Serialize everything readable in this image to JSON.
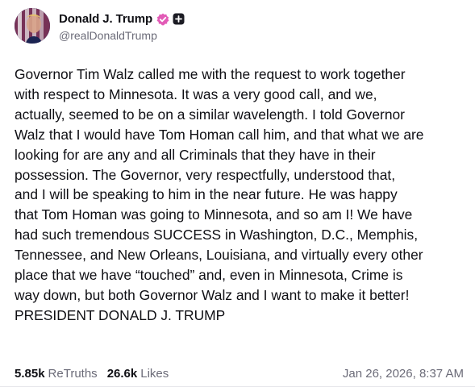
{
  "post": {
    "author": {
      "display_name": "Donald J. Trump",
      "handle": "@realDonaldTrump",
      "verified_icon": "verified-badge-icon",
      "plus_icon": "plus-square-icon",
      "verified_color": "#e25bb6"
    },
    "text": "Governor Tim Walz called me with the request to work together\nwith respect to Minnesota. It was a very good call, and we,\nactually, seemed to be on a similar wavelength. I told Governor\nWalz that I would have Tom Homan call him, and that what we are\nlooking for are any and all Criminals that they have in their\npossession. The Governor, very respectfully, understood that,\nand I will be speaking to him in the near future. He was happy\nthat Tom Homan was going to Minnesota, and so am I! We have\nhad such tremendous SUCCESS in Washington, D.C., Memphis,\nTennessee, and New Orleans, Louisiana, and virtually every other\nplace that we have “touched” and, even in Minnesota, Crime is\nway down, but both Governor Walz and I want to make it better!\nPRESIDENT DONALD J. TRUMP",
    "stats": {
      "retruths_count": "5.85k",
      "retruths_label": "ReTruths",
      "likes_count": "26.6k",
      "likes_label": "Likes"
    },
    "timestamp": "Jan 26, 2026, 8:37 AM"
  }
}
